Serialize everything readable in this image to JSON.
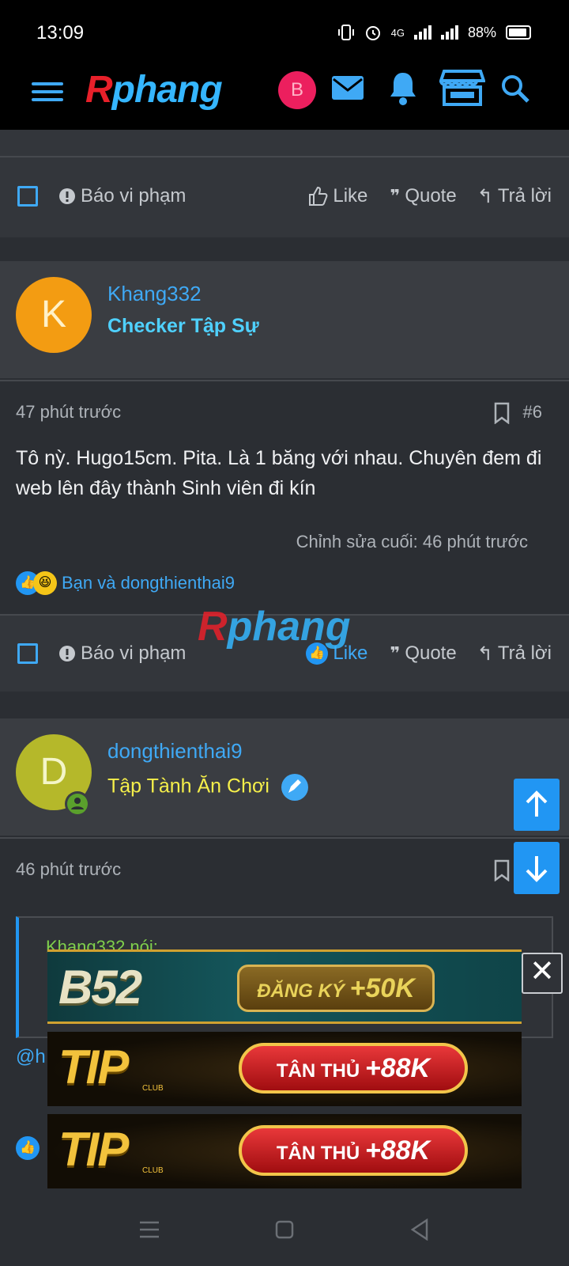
{
  "status_bar": {
    "time": "13:09",
    "network": "4G",
    "battery": "88%"
  },
  "header": {
    "logo_r": "R",
    "logo_rest": "phang",
    "user_initial": "B"
  },
  "top_actions": {
    "report": "Báo vi phạm",
    "like": "Like",
    "quote": "Quote",
    "reply": "Trả lời"
  },
  "post6": {
    "author": "Khang332",
    "author_initial": "K",
    "role": "Checker Tập Sự",
    "time": "47 phút trước",
    "number": "#6",
    "message": "Tô nỳ. Hugo15cm. Pita. Là 1 băng với nhau. Chuyên đem đi web lên đây thành Sinh viên đi kín",
    "edited": "Chỉnh sửa cuối: 46 phút trước",
    "reactions_text": "Bạn và dongthienthai9",
    "actions": {
      "report": "Báo vi phạm",
      "like": "Like",
      "quote": "Quote",
      "reply": "Trả lời"
    }
  },
  "post7": {
    "author": "dongthienthai9",
    "author_initial": "D",
    "role": "Tập Tành Ăn Chơi",
    "time": "46 phút trước",
    "quote_author": "Khang332 nói:",
    "reply_mention": "@h"
  },
  "watermark": {
    "r": "R",
    "rest": "phang"
  },
  "ads": [
    {
      "brand": "B52",
      "cta_text": "ĐĂNG KÝ",
      "cta_amount": "+50K"
    },
    {
      "brand": "TIP",
      "sub": "CLUB",
      "cta_text": "TÂN THỦ",
      "cta_amount": "+88K"
    },
    {
      "brand": "TIP",
      "sub": "CLUB",
      "cta_text": "TÂN THỦ",
      "cta_amount": "+88K"
    }
  ],
  "colors": {
    "accent": "#3fa9f5",
    "background": "#2b2e33",
    "panel": "#3a3d42",
    "role_checker": "#4fd1ff",
    "role_newbie": "#f6f04a"
  }
}
